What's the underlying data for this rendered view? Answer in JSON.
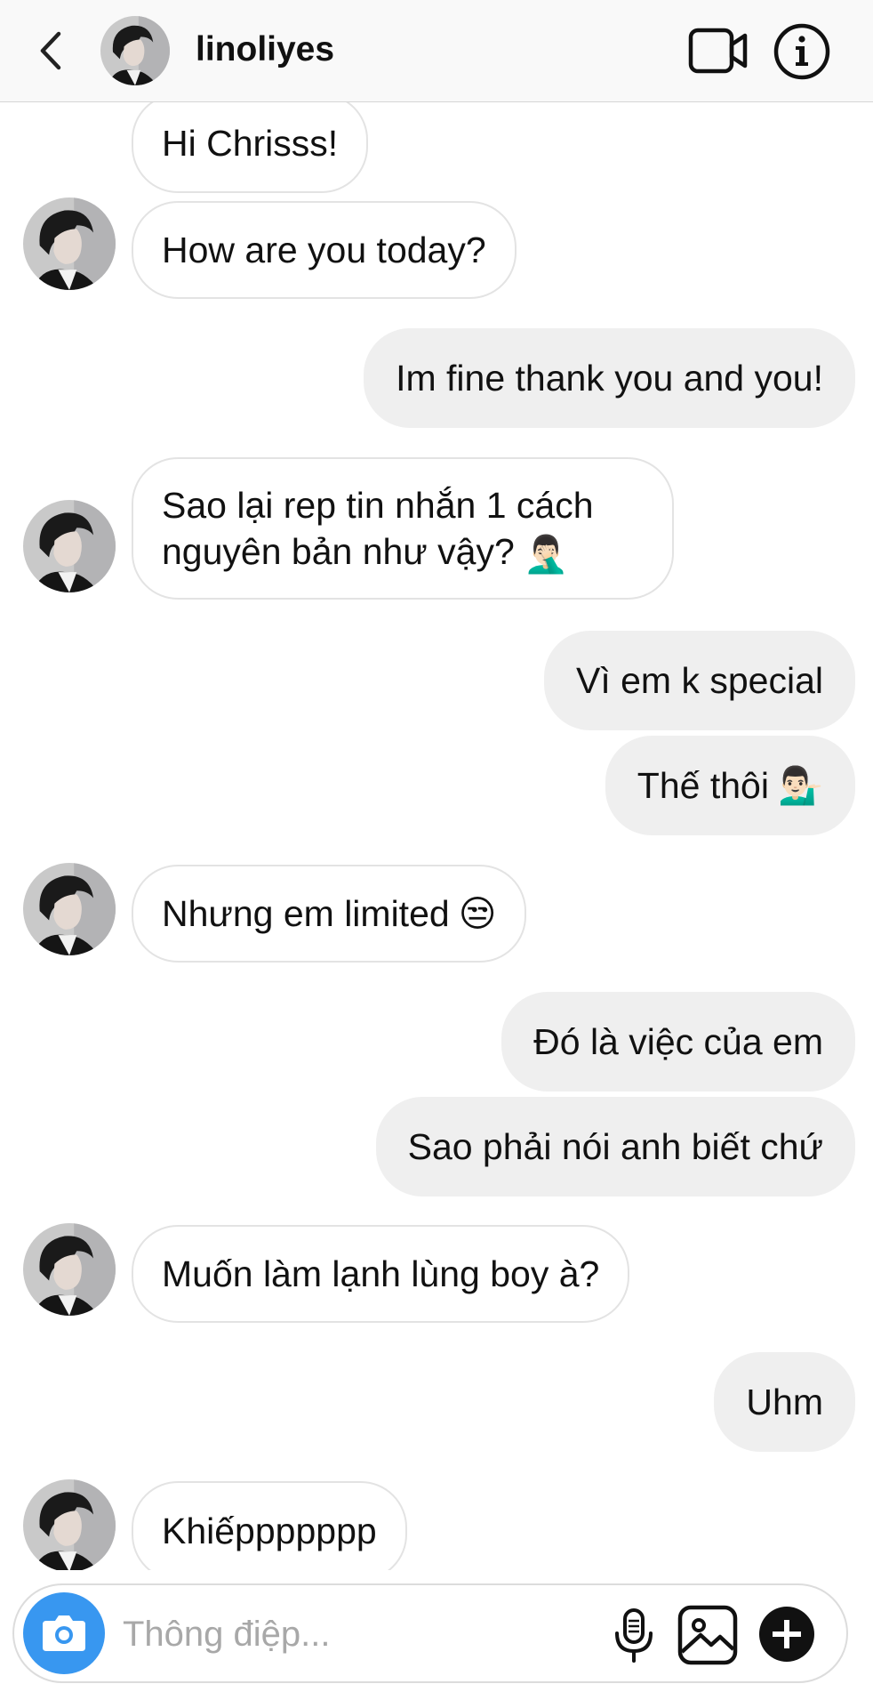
{
  "header": {
    "username": "linoliyes",
    "back_icon": "chevron-left-icon",
    "video_icon": "video-camera-icon",
    "info_icon": "info-icon"
  },
  "messages": [
    {
      "from": "them",
      "text": "Hi Chrisss!"
    },
    {
      "from": "them",
      "text": "How are you today?"
    },
    {
      "from": "me",
      "text": "Im fine thank you and you!"
    },
    {
      "from": "them",
      "text_line1": "Sao lại rep tin nhắn 1 cách",
      "text_line2": "nguyên bản như vậy?",
      "emoji": "🤦🏻‍♂️"
    },
    {
      "from": "me",
      "text": "Vì em k special"
    },
    {
      "from": "me",
      "text": "Thế thôi",
      "emoji": "💁🏻‍♂️"
    },
    {
      "from": "them",
      "text": "Nhưng em limited",
      "emoji": "😒"
    },
    {
      "from": "me",
      "text": "Đó là việc của em"
    },
    {
      "from": "me",
      "text": "Sao phải nói anh biết chứ"
    },
    {
      "from": "them",
      "text": "Muốn làm lạnh lùng boy à?"
    },
    {
      "from": "me",
      "text": "Uhm"
    },
    {
      "from": "them",
      "text": "Khiếppppppp"
    }
  ],
  "composer": {
    "placeholder": "Thông điệp...",
    "value": "",
    "camera_icon": "camera-icon",
    "mic_icon": "microphone-icon",
    "gallery_icon": "image-icon",
    "plus_icon": "plus-circle-icon"
  },
  "colors": {
    "accent": "#3897f0",
    "incoming_bubble_border": "#e3e3e3",
    "outgoing_bubble": "#efefef",
    "header_bg": "#f9f9f9"
  }
}
